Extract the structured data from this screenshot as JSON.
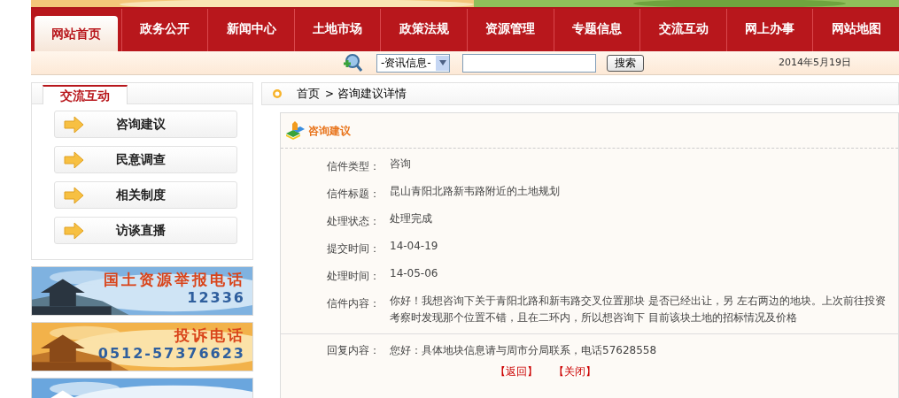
{
  "nav": [
    {
      "label": "网站首页",
      "selected": true
    },
    {
      "label": "政务公开",
      "selected": false
    },
    {
      "label": "新闻中心",
      "selected": false
    },
    {
      "label": "土地市场",
      "selected": false
    },
    {
      "label": "政策法规",
      "selected": false
    },
    {
      "label": "资源管理",
      "selected": false
    },
    {
      "label": "专题信息",
      "selected": false
    },
    {
      "label": "交流互动",
      "selected": false
    },
    {
      "label": "网上办事",
      "selected": false
    },
    {
      "label": "网站地图",
      "selected": false
    }
  ],
  "search": {
    "category": "-资讯信息-",
    "button": "搜索",
    "date": "2014年5月19日"
  },
  "sidebar": {
    "title": "交流互动",
    "items": [
      "咨询建议",
      "民意调查",
      "相关制度",
      "访谈直播"
    ]
  },
  "banners": [
    {
      "title": "国土资源举报电话",
      "number": "12336",
      "kind": "sky"
    },
    {
      "title": "投诉电话",
      "number": "0512-57376623",
      "kind": "sunset"
    },
    {
      "kind": "cloud"
    }
  ],
  "breadcrumb": {
    "home": "首页",
    "separator": ">",
    "current": "咨询建议详情"
  },
  "detail": {
    "title": "咨询建议",
    "fields": [
      {
        "label": "信件类型：",
        "value": "咨询"
      },
      {
        "label": "信件标题：",
        "value": "昆山青阳北路新韦路附近的土地规划"
      },
      {
        "label": "处理状态：",
        "value": "处理完成"
      },
      {
        "label": "提交时间：",
        "value": "14-04-19"
      },
      {
        "label": "处理时间：",
        "value": "14-05-06"
      },
      {
        "label": "信件内容：",
        "value": "你好！我想咨询下关于青阳北路和新韦路交叉位置那块 是否已经出让，另 左右两边的地块。上次前往投资考察时发现那个位置不错，且在二环内，所以想咨询下 目前该块土地的招标情况及价格"
      }
    ],
    "reply": {
      "label": "回复内容：",
      "value": "您好：具体地块信息请与周市分局联系，电话57628558"
    },
    "links": [
      "【返回】",
      "【关闭】"
    ]
  }
}
